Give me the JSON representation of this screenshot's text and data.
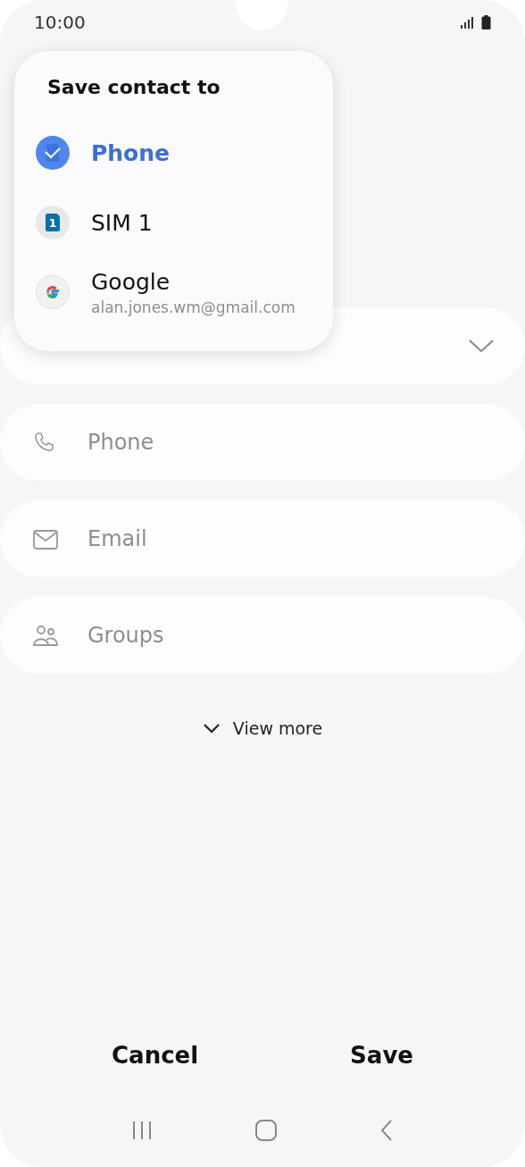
{
  "status_bar": {
    "time": "10:00"
  },
  "form": {
    "fields": [
      {
        "kind": "name"
      },
      {
        "kind": "phone",
        "placeholder": "Phone"
      },
      {
        "kind": "email",
        "placeholder": "Email"
      },
      {
        "kind": "groups",
        "placeholder": "Groups"
      }
    ],
    "view_more": "View more"
  },
  "popup": {
    "title": "Save contact to",
    "options": [
      {
        "kind": "phone",
        "label": "Phone",
        "selected": true
      },
      {
        "kind": "sim",
        "label": "SIM 1",
        "badge": "1",
        "selected": false
      },
      {
        "kind": "google",
        "label": "Google",
        "sublabel": "alan.jones.wm@gmail.com",
        "selected": false
      }
    ]
  },
  "buttons": [
    "Cancel",
    "Save"
  ]
}
